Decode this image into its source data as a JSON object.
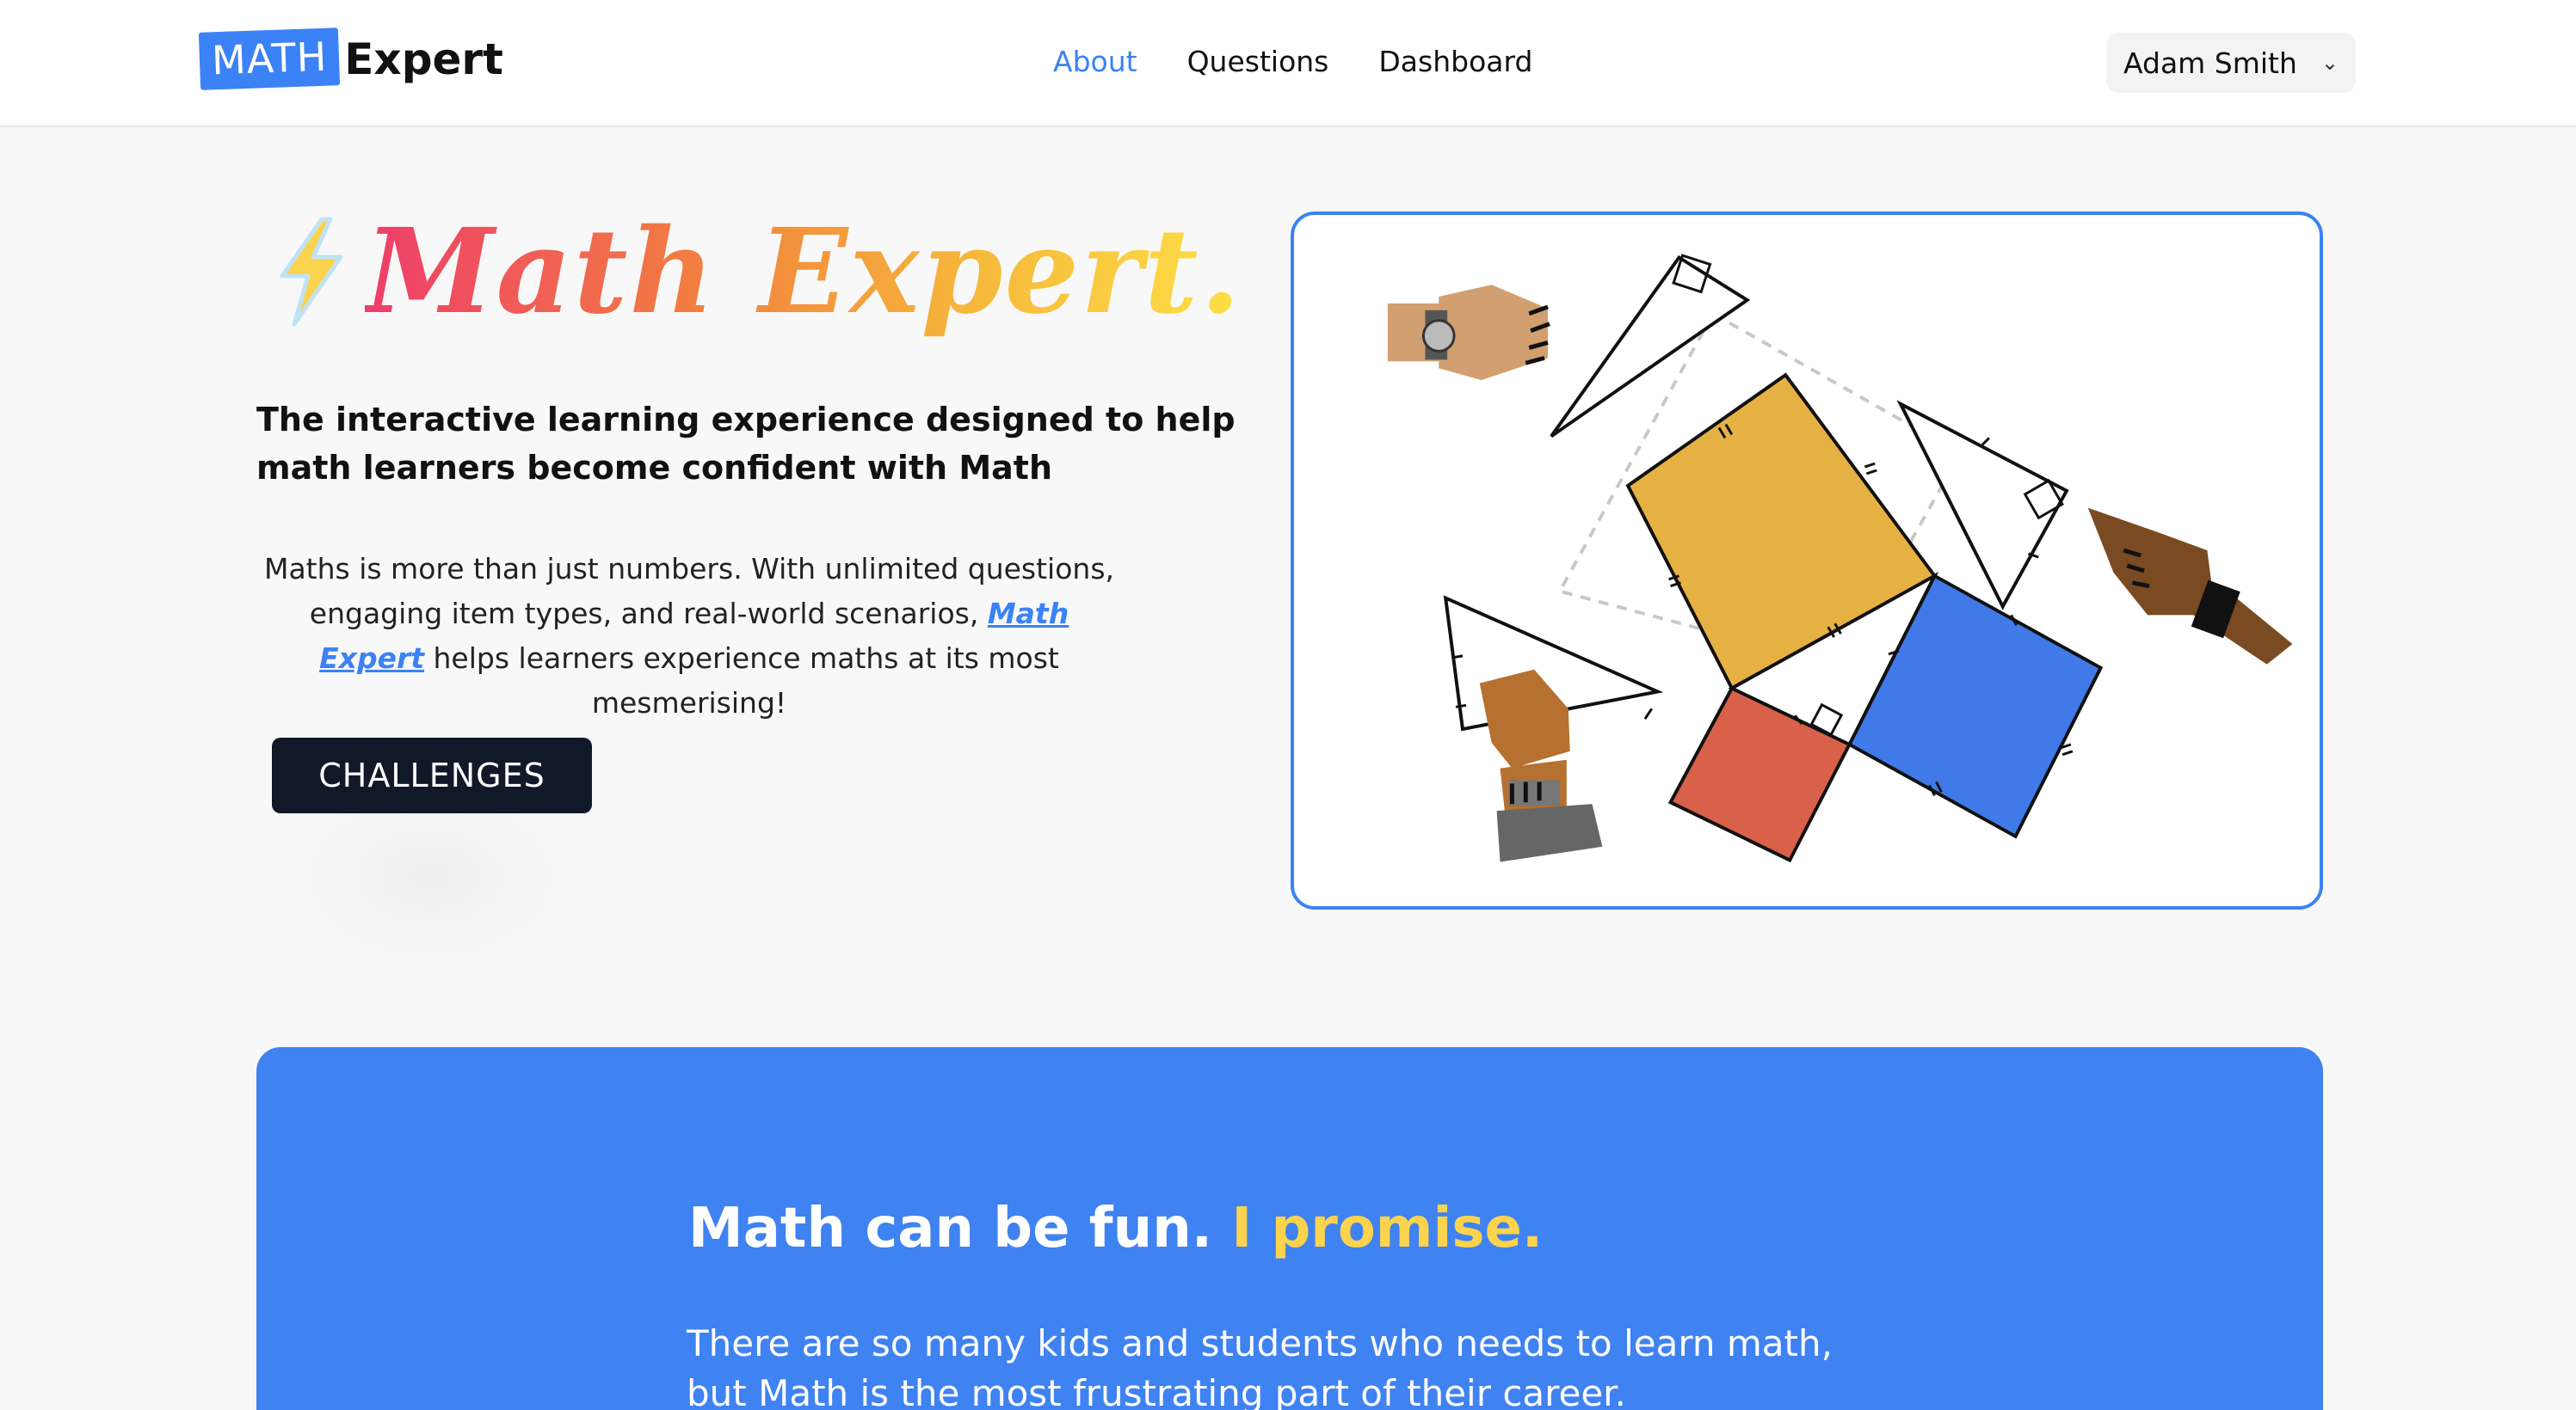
{
  "header": {
    "logo_badge": "MATH",
    "logo_text": "Expert",
    "nav": [
      {
        "label": "About",
        "active": true
      },
      {
        "label": "Questions",
        "active": false
      },
      {
        "label": "Dashboard",
        "active": false
      }
    ],
    "user_name": "Adam Smith"
  },
  "hero": {
    "title_icon": "lightning-bolt-icon",
    "title": "Math Expert.",
    "subtitle": "The interactive learning experience designed to help math learners become confident with Math",
    "description_before": "Maths is more than just numbers. With unlimited questions, engaging item types, and real-world scenarios, ",
    "description_link": "Math Expert",
    "description_after": " helps learners experience maths at its most mesmerising!",
    "cta_label": "CHALLENGES"
  },
  "promo": {
    "title_main": "Math can be fun. ",
    "title_accent": "I promise.",
    "body": "There are so many kids and students who needs to learn math, but Math is the most frustrating part of their career."
  },
  "colors": {
    "accent": "#3b82f6",
    "dark_button": "#111827",
    "promo_bg": "#3f82f2",
    "promo_accent": "#fcd34d",
    "square_yellow": "#e6b143",
    "square_blue": "#4079e8",
    "square_red": "#d9614a"
  }
}
